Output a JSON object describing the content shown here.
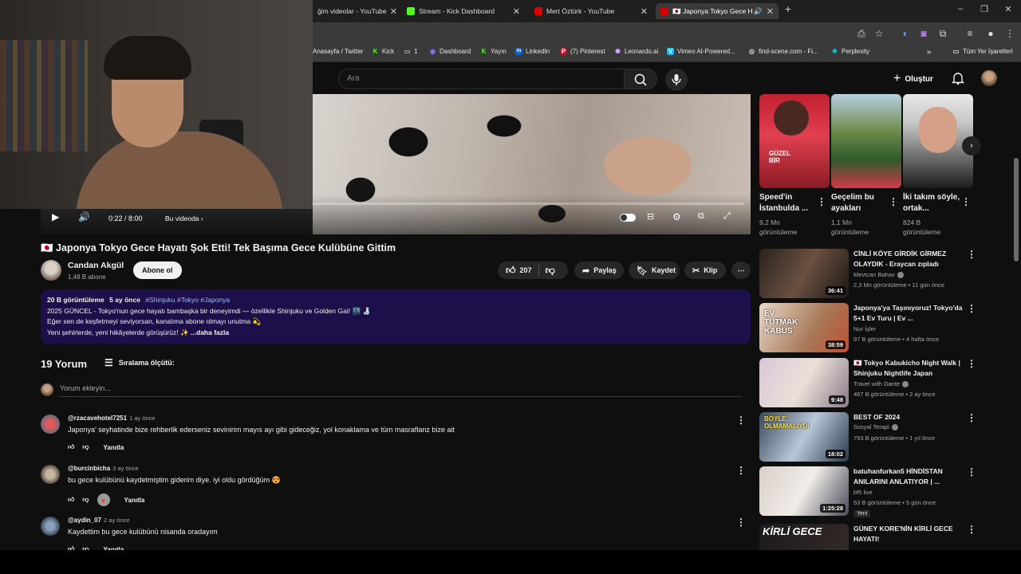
{
  "browser": {
    "tabs": [
      {
        "label": "ğim videolar - YouTube",
        "fav": "#d00"
      },
      {
        "label": "Stream - Kick Dashboard",
        "fav": "#53fc18"
      },
      {
        "label": "Mert Öztürk - YouTube",
        "fav": "#d00"
      },
      {
        "label": "🇯🇵 Japonya Tokyo Gece Hay",
        "fav": "#d00"
      }
    ],
    "new_tab": "+",
    "bookmarks": [
      {
        "label": "Anasayfa / Twitter",
        "color": "#1d9bf0",
        "glyph": "t"
      },
      {
        "label": "Kick",
        "color": "#53fc18",
        "glyph": "K"
      },
      {
        "label": "1",
        "color": "#bbb",
        "glyph": "▭"
      },
      {
        "label": "Dashboard",
        "color": "#7b7bff",
        "glyph": "◉"
      },
      {
        "label": "Yayın",
        "color": "#53fc18",
        "glyph": "K"
      },
      {
        "label": "LinkedIn",
        "color": "#0a66c2",
        "glyph": "in"
      },
      {
        "label": "(7) Pinterest",
        "color": "#e60023",
        "glyph": "P"
      },
      {
        "label": "Leonardo.ai",
        "color": "#d8a0ff",
        "glyph": "✺"
      },
      {
        "label": "Vimeo AI-Powered...",
        "color": "#1ab7ea",
        "glyph": "V"
      },
      {
        "label": "find-scene.com - Fi...",
        "color": "#ddd",
        "glyph": "◎"
      },
      {
        "label": "Perplexity",
        "color": "#20b8cd",
        "glyph": "✱"
      }
    ],
    "all_bookmarks": "Tüm Yer İşaretleri"
  },
  "header": {
    "search_placeholder": "Ara",
    "create_label": "Oluştur"
  },
  "player": {
    "time": "0:22 / 8:00",
    "chapter": "Bu videoda ›",
    "progress_fraction": 0.046
  },
  "video": {
    "title": "🇯🇵 Japonya Tokyo Gece Hayatı Şok Etti! Tek Başıma Gece Kulübüne Gittim",
    "channel": "Candan Akgül",
    "subscribers": "1,48 B abone",
    "subscribe_label": "Abone ol",
    "likes": "207",
    "share_label": "Paylaş",
    "save_label": "Kaydet",
    "clip_label": "Klip"
  },
  "description": {
    "views": "20 B görüntüleme",
    "age": "5 ay önce",
    "tags": "#Shinjuku #Tokyo #Japonya",
    "line1": "2025 GÜNCEL - Tokyo'nun gece hayatı bambaşka bir deneyimdi — özellikle Shinjuku ve Golden Gai! 🌃 🍶",
    "line2": "Eğer sen de  keşfetmeyi seviyorsan, kanalıma abone olmayı unutma 💫",
    "line3": "Yeni şehirlerde, yeni hikâyelerde görüşürüz! ✨",
    "more": "...daha fazla"
  },
  "comments": {
    "count": "19 Yorum",
    "sort_label": "Sıralama ölçütü:",
    "add_placeholder": "Yorum ekleyin...",
    "reply_label": "Yanıtla",
    "items": [
      {
        "author": "@rzacavehotel7251",
        "time": "1 ay önce",
        "text": "Japonya' seyhatinde bize rehberlik ederseniz sevinirim mayıs ayı gibi  gideceğiz, yol konaklama ve tüm masraflanz bize ait"
      },
      {
        "author": "@burcinbicha",
        "time": "3 ay önce",
        "text": "bu gece kulübünü kaydetmiştim giderim diye. iyi oldu gördüğüm 😍"
      },
      {
        "author": "@aydin_07",
        "time": "2 ay önce",
        "text": "Kaydettim bu gece kulübünü nisanda oradayım"
      }
    ]
  },
  "sidebar": {
    "shorts": [
      {
        "title": "Speed'in İstanbulda ...",
        "views": "9,2 Mn görüntüleme"
      },
      {
        "title": "Geçelim bu ayakları",
        "views": "1,1 Mn görüntüleme"
      },
      {
        "title": "İki takım söyle, ortak...",
        "views": "824 B görüntüleme"
      }
    ],
    "short_overlay_text": "GÜZEL BİR",
    "recommendations": [
      {
        "title": "CİNLİ KÖYE GİRDİK GİRMEZ OLAYDIK - Eraycan zıpladı",
        "channel": "Mevtcan Bahav",
        "views": "2,3 Mn görüntüleme • 11 gün önce",
        "duration": "36:41",
        "overlay": ""
      },
      {
        "title": "Japonya'ya Taşınıyoruz! Tokyo'da 5+1 Ev Turu | Ev ...",
        "channel": "Nur İşler",
        "views": "97 B görüntüleme • 4 hafta önce",
        "duration": "38:59",
        "overlay": "EV TUTMAK KABUS"
      },
      {
        "title": "🇯🇵 Tokyo Kabukicho Night Walk | Shinjuku Nightlife Japan",
        "channel": "Travel with Dante",
        "views": "467 B görüntüleme • 2 ay önce",
        "duration": "9:48",
        "overlay": ""
      },
      {
        "title": "BEST OF 2024",
        "channel": "Sosyal Terapi",
        "views": "793 B görüntüleme • 1 yıl önce",
        "duration": "18:02",
        "overlay": "BÖYLE OLMAMALIYDI"
      },
      {
        "title": "batuhanfurkan5 HİNDİSTAN ANILARINI ANLATIYOR | ...",
        "channel": "bf5 live",
        "views": "53 B görüntüleme • 5 gün önce",
        "duration": "1:25:28",
        "overlay": "",
        "badge": "Yeni"
      },
      {
        "title": "GÜNEY KORE'NİN KİRLİ GECE HAYATI!",
        "channel": "",
        "views": "",
        "duration": "",
        "overlay": "KİRLİ GECE"
      }
    ]
  }
}
